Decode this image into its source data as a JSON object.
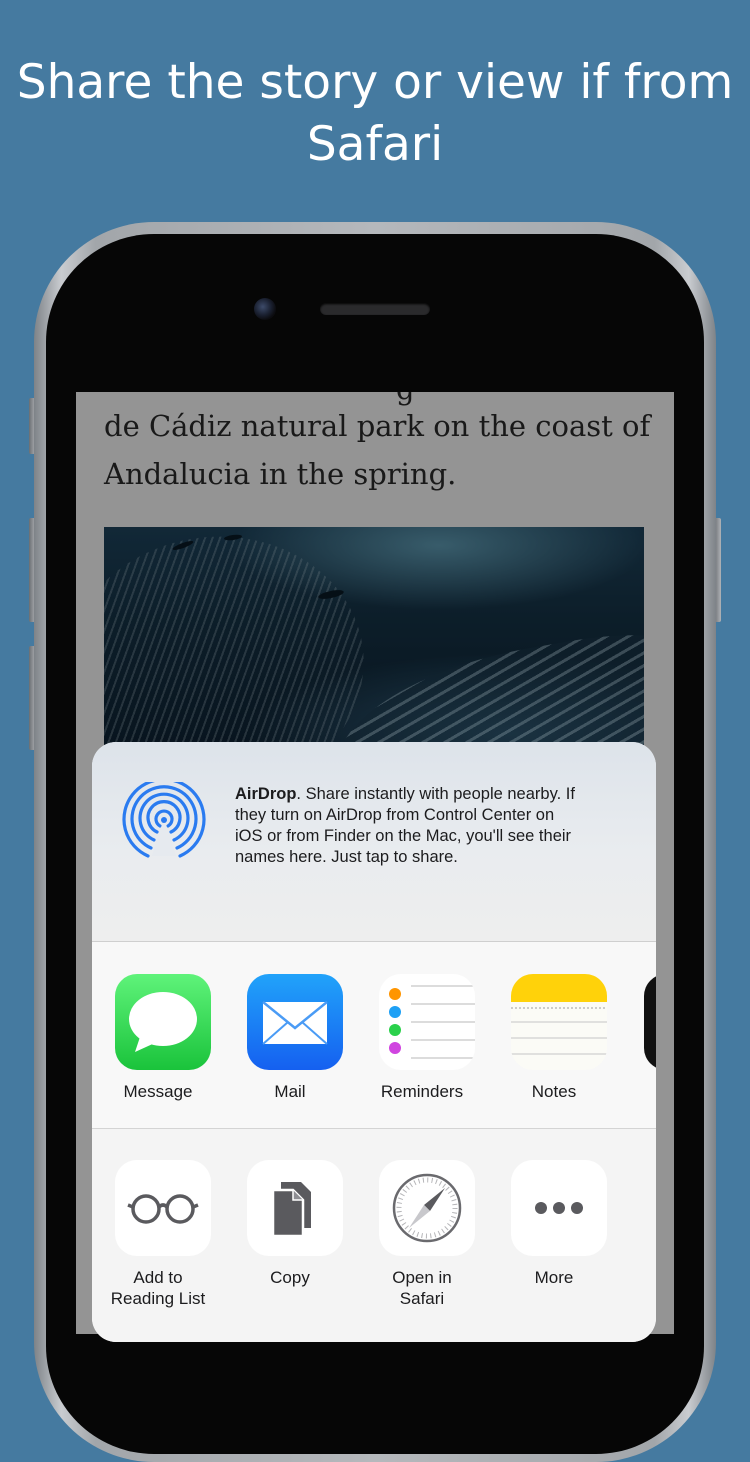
{
  "headline": {
    "line1": "Share the story or view if from",
    "line2": "Safari"
  },
  "article": {
    "line1": "de Cádiz natural park on the coast of",
    "line2": "Andalucia in the spring.",
    "cutoff_glyph": "g"
  },
  "share_sheet": {
    "airdrop": {
      "title": "AirDrop",
      "line1_rest": ". Share instantly with people nearby. If",
      "line2": "they turn on AirDrop from Control Center on",
      "line3": "iOS or from Finder on the Mac, you'll see their",
      "line4": "names here. Just tap to share."
    },
    "apps": [
      {
        "label": "Message",
        "icon": "message-icon",
        "color": "#35d04f"
      },
      {
        "label": "Mail",
        "icon": "mail-icon",
        "color": "#1e7cf4"
      },
      {
        "label": "Reminders",
        "icon": "reminders-icon",
        "color": "#ffffff"
      },
      {
        "label": "Notes",
        "icon": "notes-icon",
        "color": "#ffd20a"
      }
    ],
    "actions": [
      {
        "label_line1": "Add to",
        "label_line2": "Reading List",
        "icon": "glasses-icon"
      },
      {
        "label_line1": "Copy",
        "label_line2": "",
        "icon": "copy-icon"
      },
      {
        "label_line1": "Open in",
        "label_line2": "Safari",
        "icon": "safari-compass-icon"
      },
      {
        "label_line1": "More",
        "label_line2": "",
        "icon": "more-dots-icon"
      }
    ]
  },
  "colors": {
    "background": "#457aa0",
    "airdrop_blue": "#2a7bf0"
  }
}
